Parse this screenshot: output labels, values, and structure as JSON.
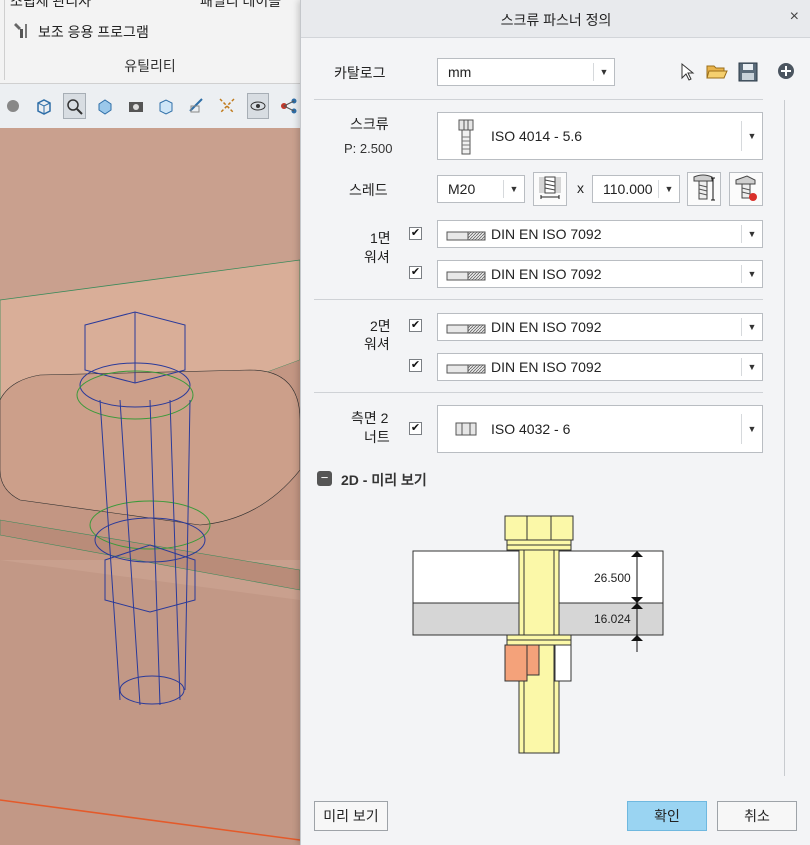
{
  "ribbon": {
    "top_item_1": "조립체 관리자",
    "top_item_2": "패밀리 테이블",
    "aux_program": "보조 응용 프로그램",
    "group_label": "유틸리티"
  },
  "dialog": {
    "title": "스크류 파스너 정의",
    "close_symbol": "×",
    "catalog_label": "카탈로그",
    "catalog_value": "mm",
    "screw_label": "스크류",
    "pitch": "P: 2.500",
    "screw_value": "ISO 4014 - 5.6",
    "thread_label": "스레드",
    "thread_value": "M20",
    "times": "x",
    "length_value": "110.000",
    "washer1_label_a": "1면",
    "washer1_label_b": "워셔",
    "washer1_a": "DIN EN ISO 7092",
    "washer1_b": "DIN EN ISO 7092",
    "washer2_label_a": "2면",
    "washer2_label_b": "워셔",
    "washer2_a": "DIN EN ISO 7092",
    "washer2_b": "DIN EN ISO 7092",
    "nut_label_a": "측면 2",
    "nut_label_b": "너트",
    "nut_value": "ISO 4032 - 6",
    "preview_toggle": "−",
    "preview_title": "2D - 미리 보기",
    "dim_1": "26.500",
    "dim_2": "16.024",
    "preview_button": "미리 보기",
    "ok_button": "확인",
    "cancel_button": "취소"
  },
  "checkboxes": {
    "washer1_a": true,
    "washer1_b": true,
    "washer2_a": true,
    "washer2_b": true,
    "nut": true
  },
  "colors": {
    "ok_button": "#9ad4f2",
    "model": "#c9a08e",
    "bolt": "#fbf8a8",
    "nut_highlight": "#f4a27a"
  }
}
